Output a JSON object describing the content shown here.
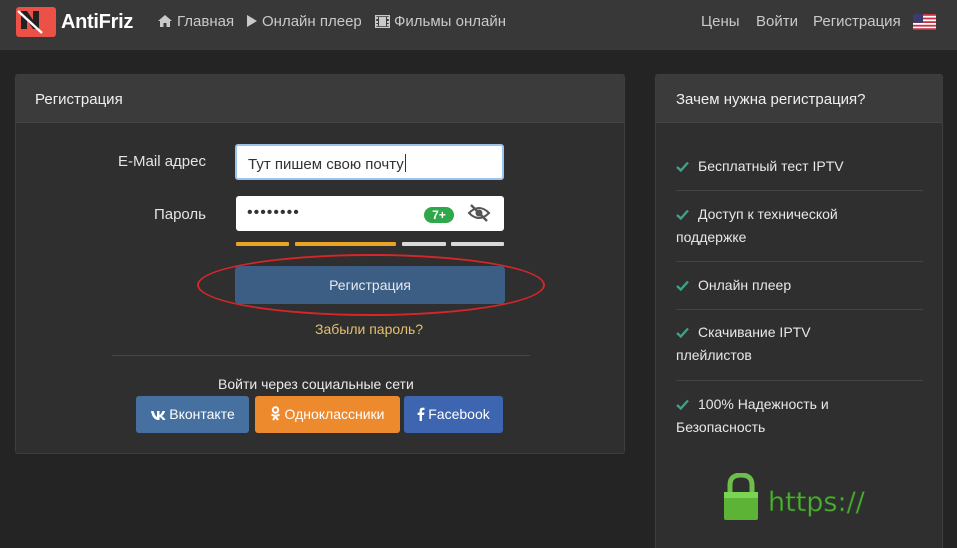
{
  "header": {
    "logo_text": "AntiFriz",
    "nav": [
      {
        "label": "Главная",
        "icon": "home-icon"
      },
      {
        "label": "Онлайн плеер",
        "icon": "play-icon"
      },
      {
        "label": "Фильмы онлайн",
        "icon": "film-icon"
      }
    ],
    "right": [
      "Цены",
      "Войти",
      "Регистрация"
    ],
    "flag": "us-flag-icon"
  },
  "registration": {
    "title": "Регистрация",
    "email_label": "E-Mail адрес",
    "email_value": "Тут пишем свою почту",
    "password_label": "Пароль",
    "password_value": "••••••••",
    "strength_badge": "7+",
    "strength_colors": [
      "#e8a422",
      "#e8a422",
      "#e8a422",
      "#d9d9d9",
      "#d9d9d9"
    ],
    "submit_label": "Регистрация",
    "forgot_label": "Забыли пароль?",
    "social_title": "Войти через социальные сети",
    "social": [
      {
        "label": "Вконтакте",
        "color": "#46709f",
        "icon": "vk-icon"
      },
      {
        "label": "Одноклассники",
        "color": "#ee8a2e",
        "icon": "ok-icon"
      },
      {
        "label": "Facebook",
        "color": "#3d65b0",
        "icon": "facebook-icon"
      }
    ]
  },
  "why": {
    "title": "Зачем нужна регистрация?",
    "items": [
      {
        "line1": "Бесплатный тест IPTV",
        "line2": ""
      },
      {
        "line1": "Доступ к технической",
        "line2": "поддержке"
      },
      {
        "line1": "Онлайн плеер",
        "line2": ""
      },
      {
        "line1": "Скачивание IPTV",
        "line2": "плейлистов"
      },
      {
        "line1": "100% Надежность и",
        "line2": "Безопасность"
      }
    ],
    "https_text": "https://"
  },
  "colors": {
    "accent_check": "#3aa38a",
    "highlight_circle": "#d6262a"
  }
}
